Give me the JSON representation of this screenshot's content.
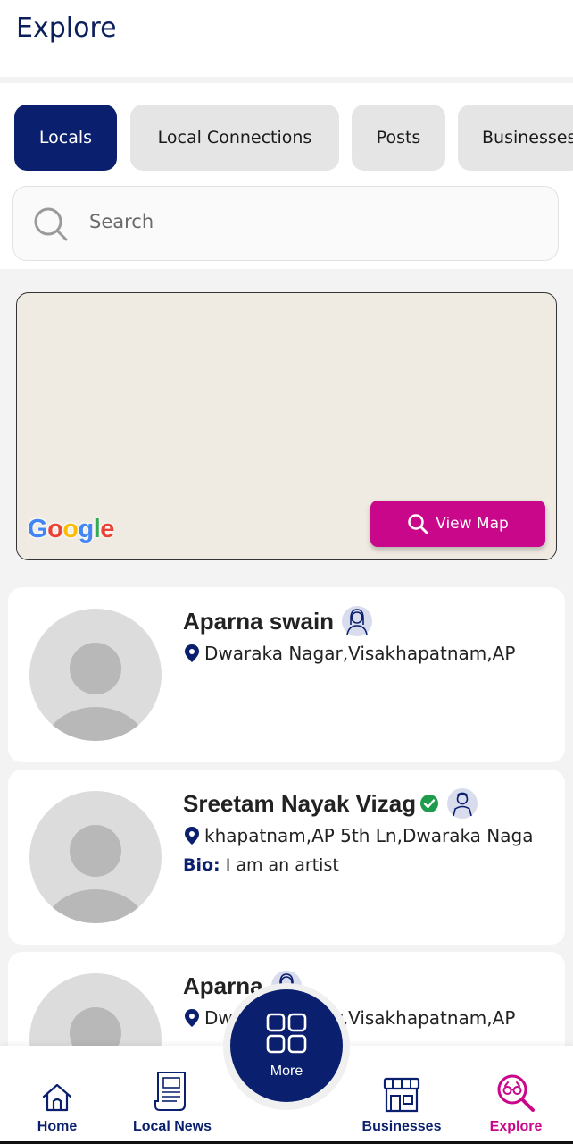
{
  "header": {
    "title": "Explore"
  },
  "tabs": [
    {
      "label": "Locals",
      "active": true
    },
    {
      "label": "Local Connections",
      "active": false
    },
    {
      "label": "Posts",
      "active": false
    },
    {
      "label": "Businesses",
      "active": false
    }
  ],
  "search": {
    "placeholder": "Search",
    "icon": "search-icon"
  },
  "map": {
    "provider_logo": "Google",
    "view_button_label": "View Map",
    "button_color": "#c8078a"
  },
  "locals": [
    {
      "name": "Aparna swain",
      "verified": false,
      "type_icon": "female-user-icon",
      "location": "Dwaraka Nagar,Visakhapatnam,AP",
      "bio_label": "",
      "bio": ""
    },
    {
      "name": "Sreetam Nayak Vizag",
      "verified": true,
      "type_icon": "male-user-icon",
      "location": "khapatnam,AP 5th Ln,Dwaraka Naga",
      "bio_label": "Bio:",
      "bio": "I am an artist"
    },
    {
      "name": "Aparna",
      "verified": false,
      "type_icon": "female-user-icon",
      "location": "Dwaraka Nagar,Visakhapatnam,AP",
      "bio_label": "",
      "bio": ""
    }
  ],
  "bottom_nav": {
    "items": [
      {
        "label": "Home",
        "icon": "home-icon",
        "active": false
      },
      {
        "label": "Local News",
        "icon": "newspaper-icon",
        "active": false
      },
      {
        "label": "Businesses",
        "icon": "store-icon",
        "active": false
      },
      {
        "label": "Explore",
        "icon": "binoculars-icon",
        "active": true
      }
    ],
    "more": {
      "label": "More",
      "icon": "grid-icon"
    }
  },
  "colors": {
    "primary": "#0a1f6e",
    "accent": "#c8078a"
  }
}
